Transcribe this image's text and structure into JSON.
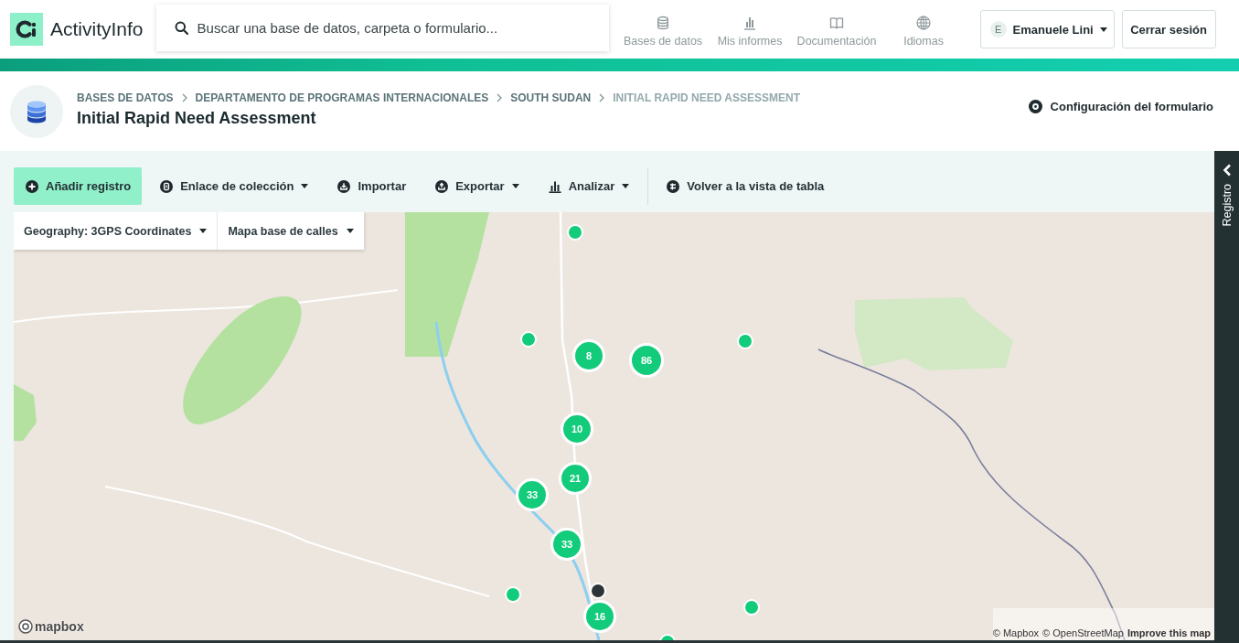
{
  "topbar": {
    "app_name": "ActivityInfo",
    "search": {
      "placeholder": "Buscar una base de datos, carpeta o formulario..."
    },
    "nav": [
      {
        "label": "Bases de datos"
      },
      {
        "label": "Mis informes"
      },
      {
        "label": "Documentación"
      },
      {
        "label": "Idiomas"
      }
    ],
    "user": {
      "initial": "E",
      "name": "Emanuele Lini"
    },
    "logout": "Cerrar sesión"
  },
  "header": {
    "breadcrumb": [
      {
        "label": "BASES DE DATOS",
        "current": false
      },
      {
        "label": "DEPARTAMENTO DE PROGRAMAS INTERNACIONALES",
        "current": false
      },
      {
        "label": "SOUTH SUDAN",
        "current": false
      },
      {
        "label": "INITIAL RAPID NEED ASSESSMENT",
        "current": true
      }
    ],
    "title": "Initial Rapid Need Assessment",
    "settings_link": "Configuración del formulario"
  },
  "toolbar": {
    "actions": [
      {
        "label": "Añadir registro",
        "kind": "primary"
      },
      {
        "label": "Enlace de colección",
        "kind": "dropdown"
      },
      {
        "label": "Importar",
        "kind": "plain"
      },
      {
        "label": "Exportar",
        "kind": "dropdown"
      },
      {
        "label": "Analizar",
        "kind": "dropdown"
      }
    ],
    "view_button": "Volver a la vista de tabla"
  },
  "map": {
    "controls": [
      {
        "label": "Geography: 3GPS Coordinates"
      },
      {
        "label": "Mapa base de calles"
      }
    ],
    "markers": [
      {
        "kind": "point",
        "color": "#13cc7b"
      },
      {
        "kind": "point",
        "color": "#13cc7b"
      },
      {
        "kind": "point",
        "color": "#13cc7b"
      },
      {
        "kind": "cluster",
        "count": "8",
        "color": "#13cc7b"
      },
      {
        "kind": "cluster",
        "count": "86",
        "color": "#13cc7b"
      },
      {
        "kind": "cluster",
        "count": "10",
        "color": "#13cc7b"
      },
      {
        "kind": "cluster",
        "count": "21",
        "color": "#13cc7b"
      },
      {
        "kind": "cluster",
        "count": "33",
        "color": "#13cc7b"
      },
      {
        "kind": "cluster",
        "count": "33",
        "color": "#13cc7b"
      },
      {
        "kind": "point",
        "color": "#2c3437"
      },
      {
        "kind": "point",
        "color": "#13cc7b"
      },
      {
        "kind": "point",
        "color": "#13cc7b"
      },
      {
        "kind": "cluster",
        "count": "16",
        "color": "#13cc7b"
      },
      {
        "kind": "point",
        "color": "#13cc7b"
      }
    ],
    "logo": "mapbox",
    "attribution": [
      "© Mapbox",
      "© OpenStreetMap",
      "Improve this map"
    ]
  },
  "side_panel": {
    "label": "Registro"
  }
}
